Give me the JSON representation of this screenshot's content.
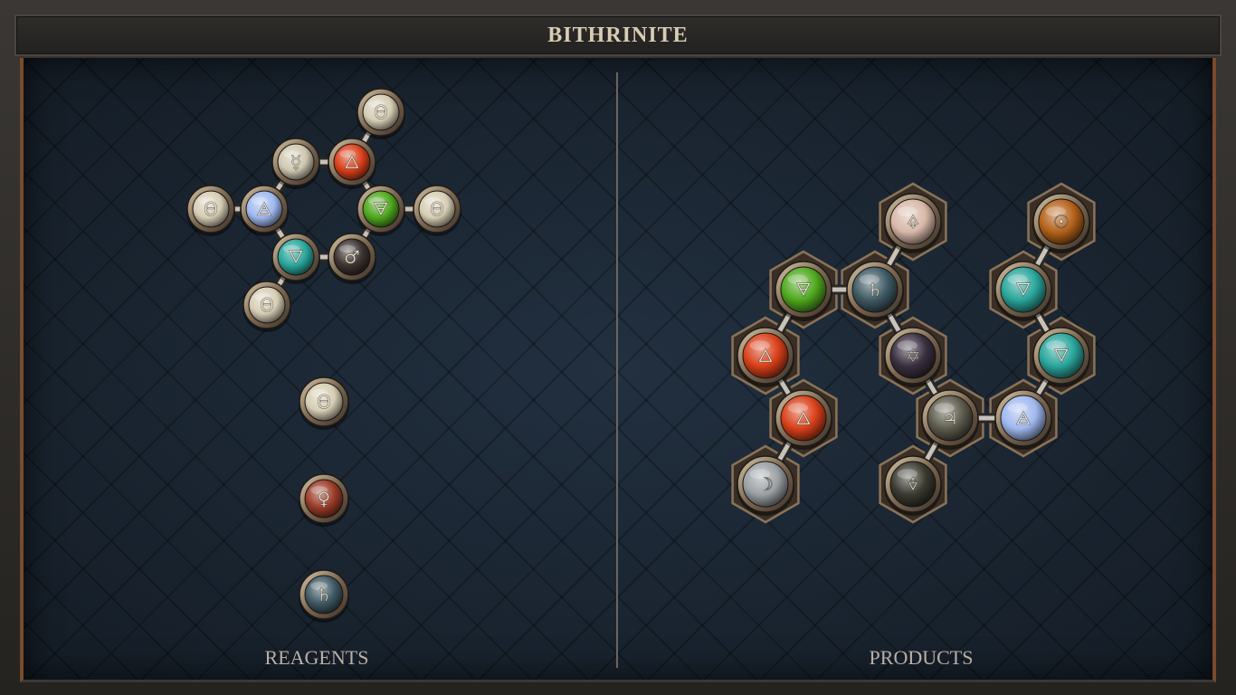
{
  "title": "BITHRINITE",
  "reagents_label": "REAGENTS",
  "products_label": "PRODUCTS",
  "colors": {
    "salt": "#d6cdb4",
    "fire": "#d9401a",
    "air": "#9fb8ef",
    "water": "#2aa59b",
    "earth": "#4fa81e",
    "quicksilver": "#cfc8b0",
    "iron": "#3c3430",
    "copper": "#9a3c28",
    "lead": "#3f5a64",
    "gold": "#b4621a",
    "silver": "#9aa0a4",
    "tin": "#5e5c4e",
    "vitae": "#d8b8a8",
    "mors": "#3a3a30",
    "quintessence": "#3a3040"
  },
  "reagents": {
    "molecule": [
      {
        "element": "salt",
        "glyph": "Θ"
      },
      {
        "element": "quicksilver",
        "glyph": "☿"
      },
      {
        "element": "fire",
        "glyph": "🜂"
      },
      {
        "element": "air",
        "glyph": "🜁"
      },
      {
        "element": "earth",
        "glyph": "🜃"
      },
      {
        "element": "salt",
        "glyph": "Θ"
      },
      {
        "element": "salt",
        "glyph": "Θ"
      },
      {
        "element": "water",
        "glyph": "🜄"
      },
      {
        "element": "iron",
        "glyph": "♂"
      },
      {
        "element": "salt",
        "glyph": "Θ"
      }
    ],
    "singles": [
      {
        "element": "salt",
        "glyph": "Θ"
      },
      {
        "element": "copper",
        "glyph": "♀"
      },
      {
        "element": "lead",
        "glyph": "♄"
      }
    ]
  },
  "products": [
    {
      "element": "vitae",
      "glyph": "🜍"
    },
    {
      "element": "gold",
      "glyph": "☉"
    },
    {
      "element": "earth",
      "glyph": "🜃"
    },
    {
      "element": "lead",
      "glyph": "♄"
    },
    {
      "element": "water",
      "glyph": "🜄"
    },
    {
      "element": "fire",
      "glyph": "🜂"
    },
    {
      "element": "quintessence",
      "glyph": "✡"
    },
    {
      "element": "water",
      "glyph": "🜄"
    },
    {
      "element": "fire",
      "glyph": "🜂"
    },
    {
      "element": "tin",
      "glyph": "♃"
    },
    {
      "element": "air",
      "glyph": "🜁"
    },
    {
      "element": "silver",
      "glyph": "☽"
    },
    {
      "element": "mors",
      "glyph": "🜞"
    }
  ]
}
